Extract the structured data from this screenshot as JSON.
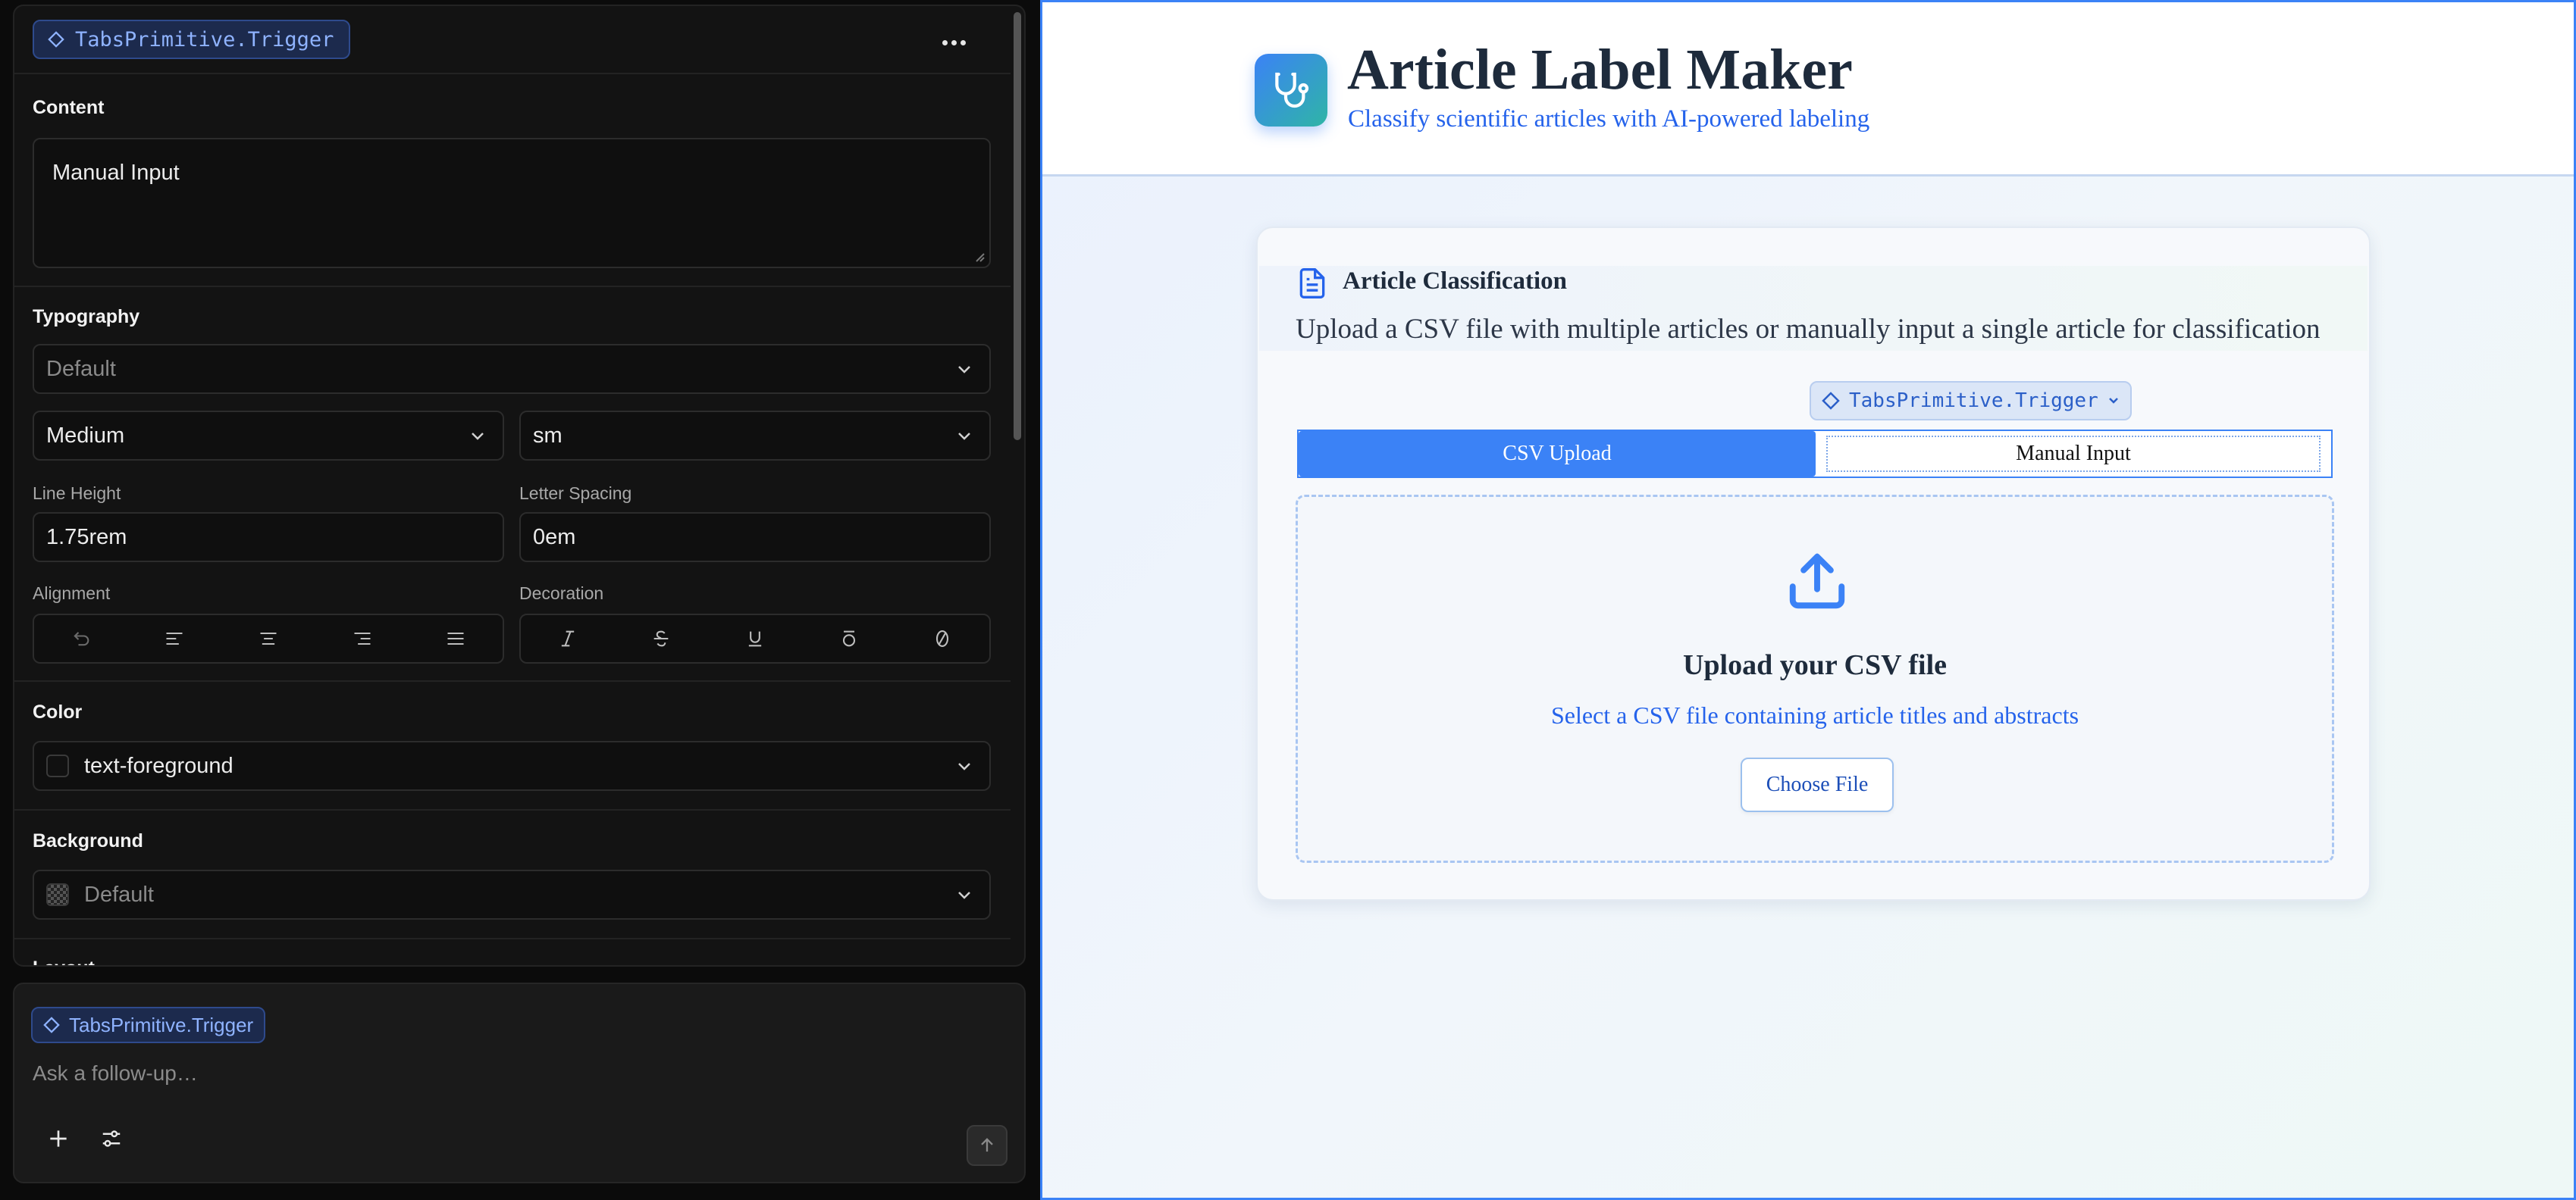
{
  "inspector": {
    "component_chip": "TabsPrimitive.Trigger",
    "more_icon": "more-horizontal-icon",
    "content": {
      "title": "Content",
      "value": "Manual Input"
    },
    "typography": {
      "title": "Typography",
      "font_family": "Default",
      "font_weight": "Medium",
      "font_size": "sm",
      "line_height_label": "Line Height",
      "line_height": "1.75rem",
      "letter_spacing_label": "Letter Spacing",
      "letter_spacing": "0em",
      "alignment_label": "Alignment",
      "alignment_icons": [
        "reset-icon",
        "align-left-icon",
        "align-center-icon",
        "align-right-icon",
        "align-justify-icon"
      ],
      "decoration_label": "Decoration",
      "decoration_icons": [
        "italic-icon",
        "strikethrough-icon",
        "underline-icon",
        "overline-icon",
        "slashed-zero-icon"
      ]
    },
    "color": {
      "title": "Color",
      "value": "text-foreground"
    },
    "background": {
      "title": "Background",
      "value": "Default"
    },
    "layout": {
      "title": "Layout"
    }
  },
  "chat": {
    "chip": "TabsPrimitive.Trigger",
    "placeholder": "Ask a follow-up…",
    "icons": [
      "plus-icon",
      "sliders-icon",
      "arrow-up-icon"
    ]
  },
  "preview": {
    "app_title": "Article Label Maker",
    "app_subtitle": "Classify scientific articles with AI-powered labeling",
    "logo_icon": "stethoscope-icon",
    "card_title": "Article Classification",
    "card_description": "Upload a CSV file with multiple articles or manually input a single article for classification",
    "trigger_chip": "TabsPrimitive.Trigger",
    "tabs": [
      {
        "label": "CSV Upload",
        "active": true
      },
      {
        "label": "Manual Input",
        "active": false
      }
    ],
    "upload_title": "Upload your CSV file",
    "upload_subtitle": "Select a CSV file containing article titles and abstracts",
    "choose_button": "Choose File"
  },
  "colors": {
    "accent": "#3b82f6",
    "logo_gradient_end": "#2fb5a6",
    "subtitle_blue": "#2563eb",
    "chip_text": "#8fb3ff"
  }
}
